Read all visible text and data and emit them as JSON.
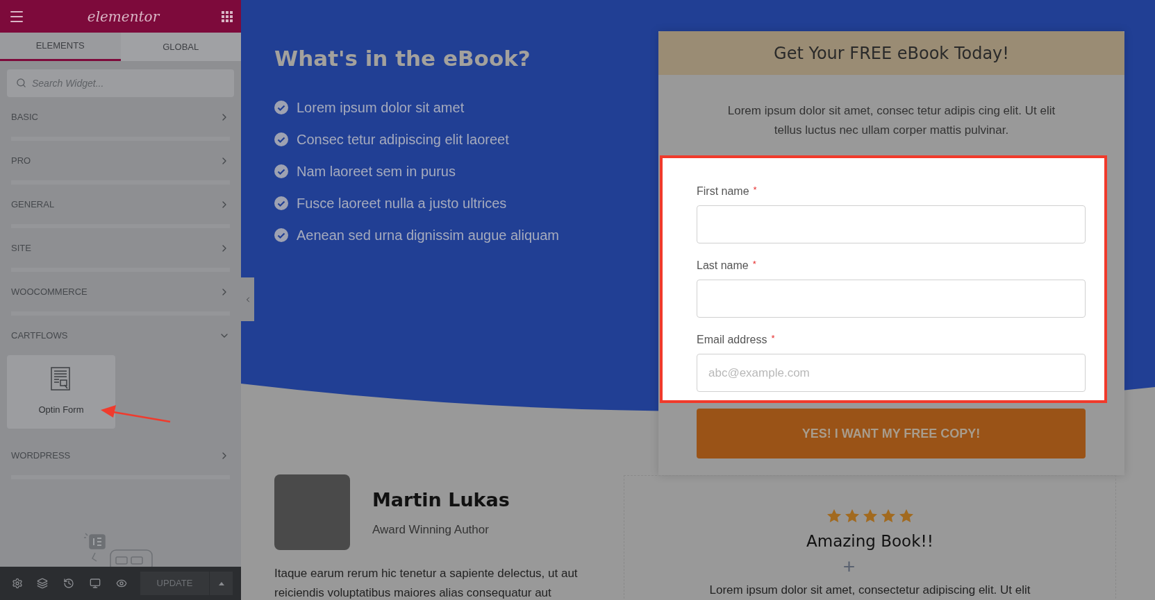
{
  "editor_panel": {
    "logo": "elementor",
    "tabs": [
      {
        "label": "ELEMENTS",
        "selected": true
      },
      {
        "label": "GLOBAL",
        "selected": false
      }
    ],
    "search": {
      "placeholder": "Search Widget..."
    },
    "categories": [
      {
        "label": "BASIC",
        "expanded": false
      },
      {
        "label": "PRO",
        "expanded": false
      },
      {
        "label": "GENERAL",
        "expanded": false
      },
      {
        "label": "SITE",
        "expanded": false
      },
      {
        "label": "WOOCOMMERCE",
        "expanded": false
      },
      {
        "label": "CARTFLOWS",
        "expanded": true,
        "children": [
          {
            "label": "Optin Form"
          }
        ]
      },
      {
        "label": "WORDPRESS",
        "expanded": false
      }
    ],
    "update_button": "UPDATE"
  },
  "hero": {
    "title": "What's in the eBook?",
    "bullets": [
      "Lorem ipsum dolor sit amet",
      "Consec tetur adipiscing elit laoreet",
      "Nam laoreet sem in purus",
      "Fusce laoreet nulla a justo ultrices",
      "Aenean sed urna dignissim augue aliquam"
    ]
  },
  "optin_card": {
    "title": "Get Your FREE eBook Today!",
    "description": "Lorem ipsum dolor sit amet, consec tetur adipis cing elit. Ut elit tellus luctus nec ullam corper mattis pulvinar.",
    "fields": [
      {
        "label": "First name",
        "required_mark": "*"
      },
      {
        "label": "Last name",
        "required_mark": "*"
      },
      {
        "label": "Email address",
        "required_mark": "*",
        "placeholder": "abc@example.com"
      }
    ],
    "submit_button": "YES! I WANT MY FREE COPY!"
  },
  "author": {
    "name": "Martin Lukas",
    "role": "Award Winning Author",
    "bio": "Itaque earum rerum hic tenetur a sapiente delectus, ut aut reiciendis voluptatibus maiores alias consequatur aut"
  },
  "testimonial": {
    "stars": 5,
    "title": "Amazing Book!!",
    "plus": "+",
    "text": "Lorem ipsum dolor sit amet, consectetur adipiscing elit. Ut elit"
  }
}
